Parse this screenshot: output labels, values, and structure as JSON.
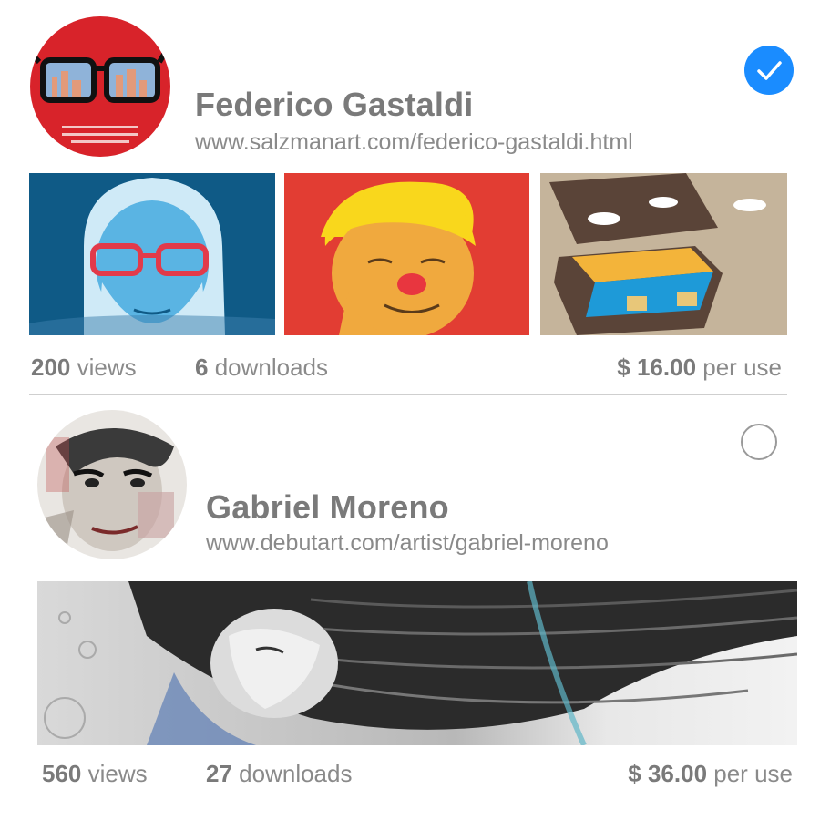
{
  "artists": [
    {
      "name": "Federico Gastaldi",
      "url": "www.salzmanart.com/federico-gastaldi.html",
      "selected": true,
      "views_count": "200",
      "views_label": "views",
      "downloads_count": "6",
      "downloads_label": "downloads",
      "price": "$ 16.00",
      "price_suffix": "per use",
      "thumbnails": [
        "old-man-glasses-portrait",
        "clown-nose-portrait",
        "suitcase-landscape"
      ]
    },
    {
      "name": "Gabriel Moreno",
      "url": "www.debutart.com/artist/gabriel-moreno",
      "selected": false,
      "views_count": "560",
      "views_label": "views",
      "downloads_count": "27",
      "downloads_label": "downloads",
      "price": "$ 36.00",
      "price_suffix": "per use",
      "thumbnails": [
        "woman-flowing-hair-illustration"
      ]
    }
  ],
  "colors": {
    "accent": "#1a8cff",
    "text": "#7a7a7a",
    "divider": "#cfcfcf"
  },
  "icons": {
    "checked": "checkmark-icon",
    "unchecked": "empty-circle-icon"
  }
}
